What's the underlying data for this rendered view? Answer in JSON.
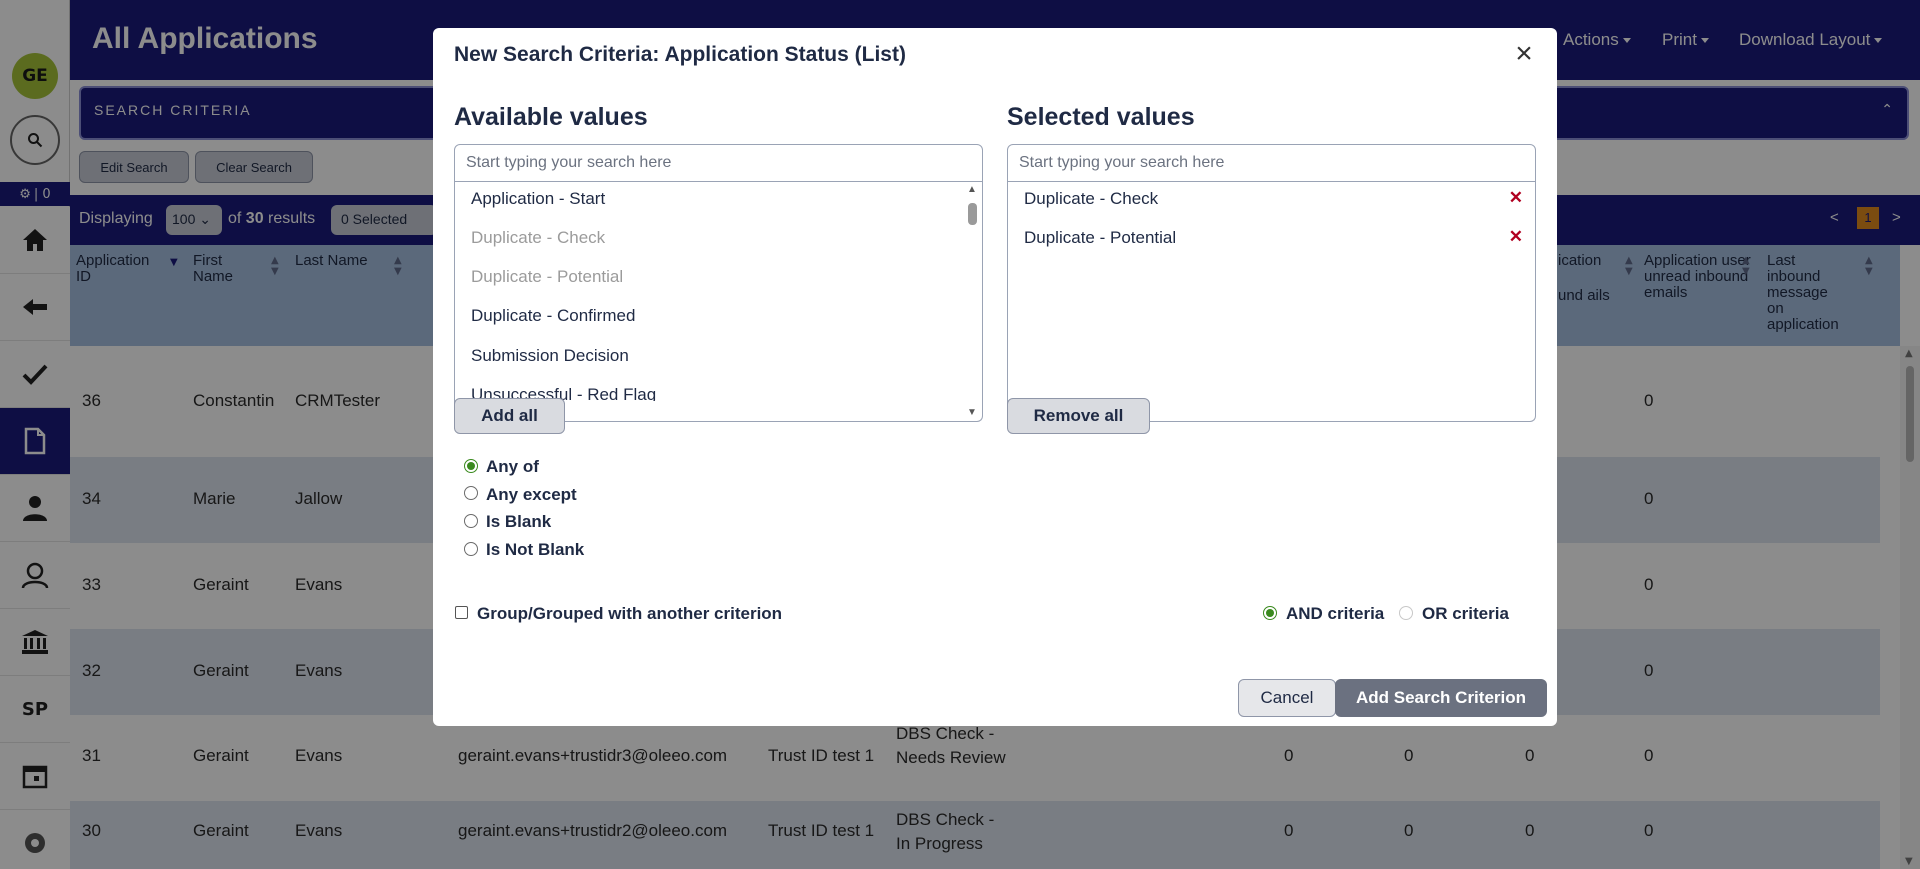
{
  "sidebar": {
    "avatar_initials": "GE",
    "counter_text": "| 0",
    "items": [
      {
        "name": "home-icon"
      },
      {
        "name": "back-arrow-icon"
      },
      {
        "name": "check-icon"
      },
      {
        "name": "document-icon"
      },
      {
        "name": "user-icon"
      },
      {
        "name": "user-search-icon"
      },
      {
        "name": "bank-icon"
      },
      {
        "name": "sp-item",
        "label": "SP"
      },
      {
        "name": "calendar-icon"
      },
      {
        "name": "settings-icon"
      }
    ]
  },
  "header": {
    "title": "All Applications",
    "menus": [
      "Actions",
      "Print",
      "Download Layout"
    ],
    "search_criteria_label": "SEARCH CRITERIA",
    "edit_search": "Edit Search",
    "clear_search": "Clear Search"
  },
  "results_bar": {
    "displaying": "Displaying",
    "per_page": "100",
    "of_text": "of",
    "count": "30",
    "results_text": "results",
    "selected": "0 Selected",
    "page": "1",
    "prev": "<",
    "next": ">"
  },
  "table": {
    "headers": {
      "application_id": "Application ID",
      "first_name": "First Name",
      "last_name": "Last Name",
      "partial_col_a": "ication",
      "partial_col_b": "und ails",
      "unread_inbound": "Application user unread inbound emails",
      "last_inbound": "Last inbound message on application"
    },
    "rows": [
      {
        "id": "36",
        "first": "Constantin",
        "last": "CRMTester",
        "email": "",
        "trust": "",
        "status": "",
        "n1": "",
        "n2": "",
        "n3": "",
        "unread": "0"
      },
      {
        "id": "34",
        "first": "Marie",
        "last": "Jallow",
        "email": "",
        "trust": "",
        "status": "",
        "n1": "",
        "n2": "",
        "n3": "",
        "unread": "0"
      },
      {
        "id": "33",
        "first": "Geraint",
        "last": "Evans",
        "email": "",
        "trust": "",
        "status": "",
        "n1": "",
        "n2": "",
        "n3": "",
        "unread": "0"
      },
      {
        "id": "32",
        "first": "Geraint",
        "last": "Evans",
        "email": "",
        "trust": "",
        "status": "",
        "n1": "",
        "n2": "",
        "n3": "",
        "unread": "0"
      },
      {
        "id": "31",
        "first": "Geraint",
        "last": "Evans",
        "email": "geraint.evans+trustidr3@oleeo.com",
        "trust": "Trust ID test 1",
        "status": "DBS Check - Needs Review",
        "n1": "0",
        "n2": "0",
        "n3": "0",
        "unread": "0"
      },
      {
        "id": "30",
        "first": "Geraint",
        "last": "Evans",
        "email": "geraint.evans+trustidr2@oleeo.com",
        "trust": "Trust ID test 1",
        "status": "DBS Check - In Progress",
        "n1": "0",
        "n2": "0",
        "n3": "0",
        "unread": "0"
      }
    ]
  },
  "modal": {
    "title": "New Search Criteria: Application Status (List)",
    "available_title": "Available values",
    "selected_title": "Selected values",
    "search_placeholder": "Start typing your search here",
    "available_items": [
      {
        "label": "Application - Start",
        "disabled": false
      },
      {
        "label": "Duplicate - Check",
        "disabled": true
      },
      {
        "label": "Duplicate - Potential",
        "disabled": true
      },
      {
        "label": "Duplicate - Confirmed",
        "disabled": false
      },
      {
        "label": "Submission Decision",
        "disabled": false
      },
      {
        "label": "Unsuccessful - Red Flag",
        "disabled": false
      }
    ],
    "selected_items": [
      "Duplicate - Check",
      "Duplicate - Potential"
    ],
    "add_all": "Add all",
    "remove_all": "Remove all",
    "match_options": [
      {
        "label": "Any of",
        "selected": true
      },
      {
        "label": "Any except",
        "selected": false
      },
      {
        "label": "Is Blank",
        "selected": false
      },
      {
        "label": "Is Not Blank",
        "selected": false
      }
    ],
    "group_label": "Group/Grouped with another criterion",
    "and_label": "AND criteria",
    "or_label": "OR criteria",
    "cancel": "Cancel",
    "add_criterion": "Add Search Criterion"
  },
  "colors": {
    "brand_navy": "#1b1a7c",
    "table_header": "#a7c0e0",
    "row_alt": "#dde4ef",
    "remove_red": "#b00020",
    "radio_green": "#3a8a1e",
    "page_highlight": "#e08a1e",
    "avatar_green": "#a6c43a"
  }
}
